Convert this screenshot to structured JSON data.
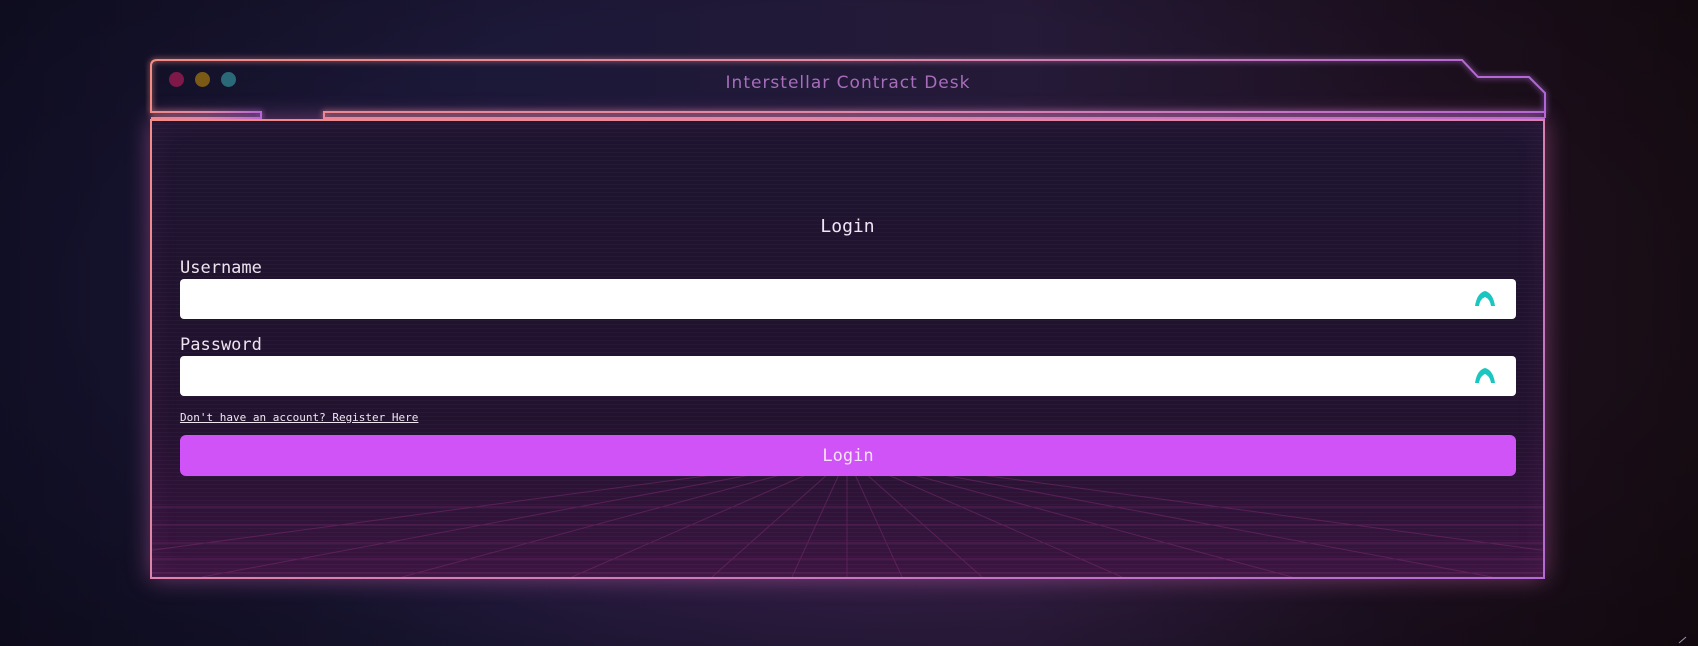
{
  "window": {
    "title": "Interstellar Contract Desk",
    "controls": [
      "close",
      "minimize",
      "maximize"
    ]
  },
  "form": {
    "heading": "Login",
    "username": {
      "label": "Username",
      "value": "",
      "placeholder": ""
    },
    "password": {
      "label": "Password",
      "value": "",
      "placeholder": ""
    },
    "register_link": "Don't have an account? Register Here",
    "submit_label": "Login"
  },
  "icons": {
    "field_icon": "password-manager-icon"
  },
  "colors": {
    "accent_button": "#cf53f7",
    "title_text": "#a76dbb",
    "frame_pink": "#e085a8",
    "frame_purple": "#b36ad6",
    "frame_yellow": "#f2cf6a",
    "field_icon": "#19c6c0",
    "traffic_red": "#7e1848",
    "traffic_yellow": "#7a5a14",
    "traffic_green": "#2a6a78"
  }
}
